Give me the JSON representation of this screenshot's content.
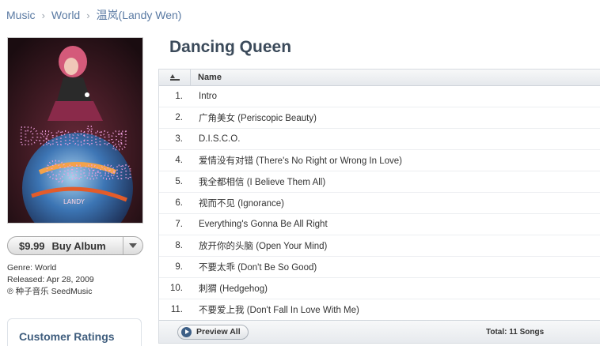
{
  "breadcrumb": {
    "items": [
      "Music",
      "World",
      "温岚(Landy Wen)"
    ]
  },
  "album": {
    "title": "Dancing Queen",
    "cover_text": "Dancing Queen"
  },
  "buy": {
    "price": "$9.99",
    "label": "Buy Album"
  },
  "meta": {
    "genre": "Genre: World",
    "released": "Released: Apr 28, 2009",
    "copyright": "℗ 种子音乐 SeedMusic"
  },
  "ratings": {
    "title": "Customer Ratings"
  },
  "tracklist": {
    "header_name": "Name",
    "tracks": [
      {
        "num": "1.",
        "title": "Intro"
      },
      {
        "num": "2.",
        "title": "广角美女 (Periscopic Beauty)"
      },
      {
        "num": "3.",
        "title": "D.I.S.C.O."
      },
      {
        "num": "4.",
        "title": "爱情没有对错 (There's No Right or Wrong In Love)"
      },
      {
        "num": "5.",
        "title": "我全都相信 (I Believe Them All)"
      },
      {
        "num": "6.",
        "title": "视而不见 (Ignorance)"
      },
      {
        "num": "7.",
        "title": "Everything's Gonna Be All Right"
      },
      {
        "num": "8.",
        "title": "放开你的头脑 (Open Your Mind)"
      },
      {
        "num": "9.",
        "title": "不要太乖 (Don't Be So Good)"
      },
      {
        "num": "10.",
        "title": "刺猬 (Hedgehog)"
      },
      {
        "num": "11.",
        "title": "不要爱上我 (Don't Fall In Love With Me)"
      }
    ],
    "preview_label": "Preview All",
    "total": "Total: 11 Songs"
  },
  "colors": {
    "link": "#5a7aa3",
    "title": "#3b4a5a",
    "accent": "#3d5f86"
  }
}
